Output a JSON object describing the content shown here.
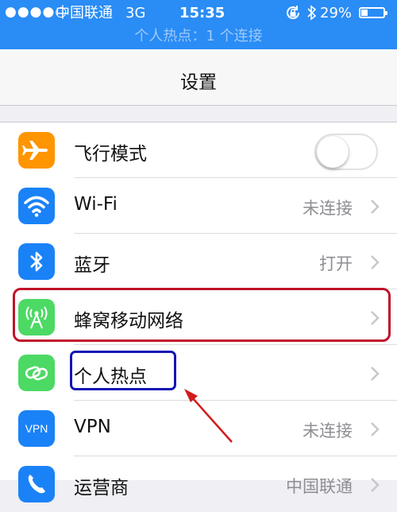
{
  "status_bar": {
    "signal": "●●●●○",
    "carrier": "中国联通",
    "network": "3G",
    "time": "15:35",
    "bluetooth_icon": "bluetooth-icon",
    "battery": "29%",
    "battery_level": 0.29,
    "hotspot_banner": "个人热点：1 个连接"
  },
  "nav": {
    "title": "设置"
  },
  "rows": [
    {
      "label": "飞行模式",
      "icon": "airplane-icon",
      "color": "#ff9500",
      "toggle": false
    },
    {
      "label": "Wi-Fi",
      "value": "未连接",
      "icon": "wifi-icon",
      "color": "#1a82f7"
    },
    {
      "label": "蓝牙",
      "value": "打开",
      "icon": "bluetooth-icon",
      "color": "#1a82f7"
    },
    {
      "label": "蜂窝移动网络",
      "icon": "cellular-icon",
      "color": "#4cd964"
    },
    {
      "label": "个人热点",
      "icon": "hotspot-icon",
      "color": "#4cd964"
    },
    {
      "label": "VPN",
      "value": "未连接",
      "icon": "vpn-icon",
      "icon_text": "VPN",
      "color": "#1a82f7"
    },
    {
      "label": "运营商",
      "value": "中国联通",
      "icon": "phone-icon",
      "color": "#1a82f7"
    }
  ],
  "annotations": {
    "cellular_box_color": "#c0142a",
    "hotspot_box_color": "#1414b4",
    "arrow_color": "#d01c1c"
  }
}
